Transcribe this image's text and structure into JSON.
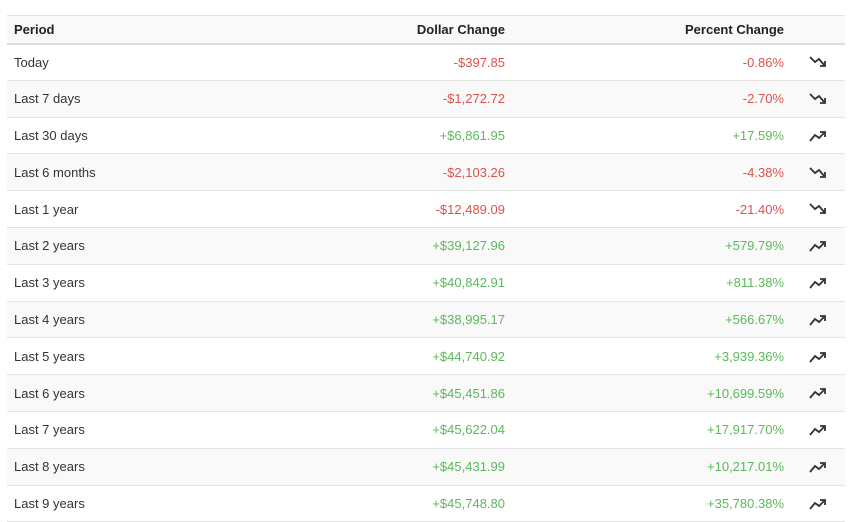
{
  "table": {
    "headers": {
      "period": "Period",
      "dollar": "Dollar Change",
      "percent": "Percent Change"
    },
    "colors": {
      "negative": "#d9534f",
      "positive": "#5cb85c"
    },
    "rows": [
      {
        "period": "Today",
        "dollar": "-$397.85",
        "percent": "-0.86%",
        "trend": "trending-down-icon"
      },
      {
        "period": "Last 7 days",
        "dollar": "-$1,272.72",
        "percent": "-2.70%",
        "trend": "trending-down-icon"
      },
      {
        "period": "Last 30 days",
        "dollar": "+$6,861.95",
        "percent": "+17.59%",
        "trend": "trending-up-icon"
      },
      {
        "period": "Last 6 months",
        "dollar": "-$2,103.26",
        "percent": "-4.38%",
        "trend": "trending-down-icon"
      },
      {
        "period": "Last 1 year",
        "dollar": "-$12,489.09",
        "percent": "-21.40%",
        "trend": "trending-down-icon"
      },
      {
        "period": "Last 2 years",
        "dollar": "+$39,127.96",
        "percent": "+579.79%",
        "trend": "trending-up-icon"
      },
      {
        "period": "Last 3 years",
        "dollar": "+$40,842.91",
        "percent": "+811.38%",
        "trend": "trending-up-icon"
      },
      {
        "period": "Last 4 years",
        "dollar": "+$38,995.17",
        "percent": "+566.67%",
        "trend": "trending-up-icon"
      },
      {
        "period": "Last 5 years",
        "dollar": "+$44,740.92",
        "percent": "+3,939.36%",
        "trend": "trending-up-icon"
      },
      {
        "period": "Last 6 years",
        "dollar": "+$45,451.86",
        "percent": "+10,699.59%",
        "trend": "trending-up-icon"
      },
      {
        "period": "Last 7 years",
        "dollar": "+$45,622.04",
        "percent": "+17,917.70%",
        "trend": "trending-up-icon"
      },
      {
        "period": "Last 8 years",
        "dollar": "+$45,431.99",
        "percent": "+10,217.01%",
        "trend": "trending-up-icon"
      },
      {
        "period": "Last 9 years",
        "dollar": "+$45,748.80",
        "percent": "+35,780.38%",
        "trend": "trending-up-icon"
      }
    ]
  }
}
